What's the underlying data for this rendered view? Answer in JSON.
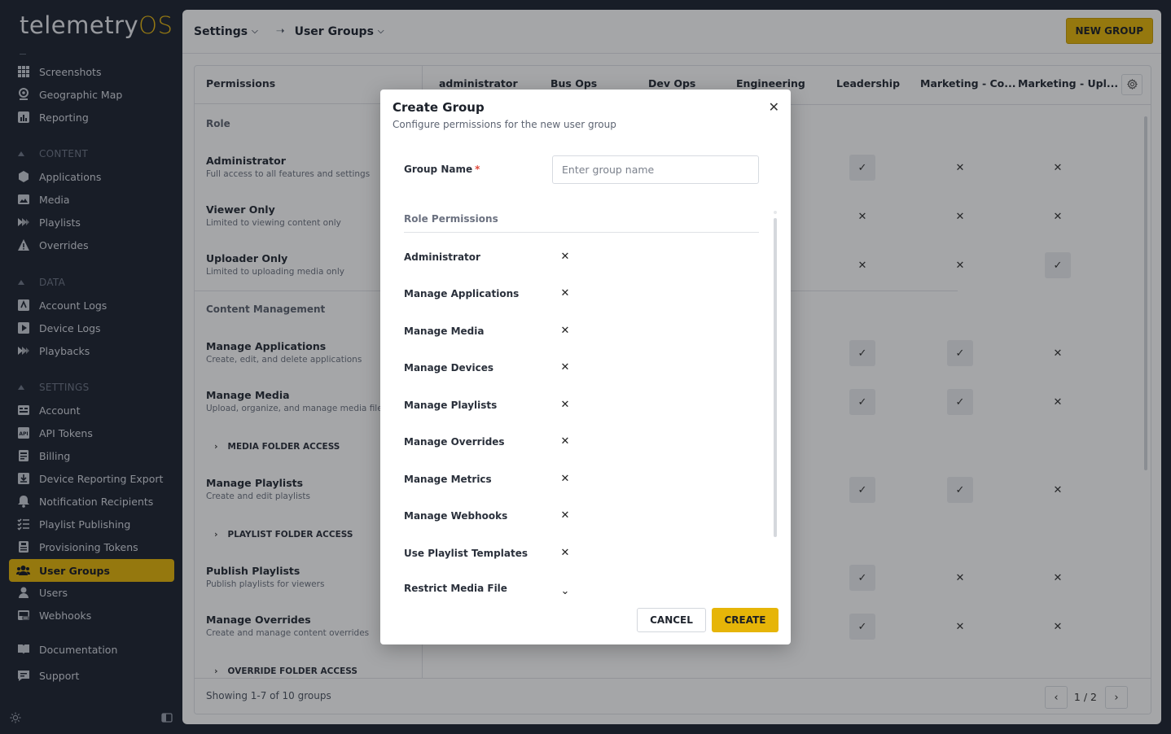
{
  "app": {
    "logo_main": "telemetry",
    "logo_accent": "OS"
  },
  "sidebar": {
    "items_top": [
      {
        "label": "Screenshots",
        "icon": "grid-icon"
      },
      {
        "label": "Geographic Map",
        "icon": "map-pin-icon"
      },
      {
        "label": "Reporting",
        "icon": "chart-icon"
      }
    ],
    "content_section": "CONTENT",
    "content_items": [
      {
        "label": "Applications",
        "icon": "cube-icon"
      },
      {
        "label": "Media",
        "icon": "image-icon"
      },
      {
        "label": "Playlists",
        "icon": "playlist-icon"
      },
      {
        "label": "Overrides",
        "icon": "warning-icon"
      }
    ],
    "data_section": "DATA",
    "data_items": [
      {
        "label": "Account Logs",
        "icon": "log-icon"
      },
      {
        "label": "Device Logs",
        "icon": "play-icon"
      },
      {
        "label": "Playbacks",
        "icon": "playback-icon"
      }
    ],
    "settings_section": "SETTINGS",
    "settings_items": [
      {
        "label": "Account",
        "icon": "id-card-icon"
      },
      {
        "label": "API Tokens",
        "icon": "api-icon"
      },
      {
        "label": "Billing",
        "icon": "billing-icon"
      },
      {
        "label": "Device Reporting Export",
        "icon": "download-icon"
      },
      {
        "label": "Notification Recipients",
        "icon": "bell-icon"
      },
      {
        "label": "Playlist Publishing",
        "icon": "checklist-icon"
      },
      {
        "label": "Provisioning Tokens",
        "icon": "token-icon"
      },
      {
        "label": "User Groups",
        "icon": "users-icon",
        "active": true
      },
      {
        "label": "Users",
        "icon": "user-icon"
      },
      {
        "label": "Webhooks",
        "icon": "webhook-icon"
      }
    ],
    "footer_items": [
      {
        "label": "Documentation",
        "icon": "book-icon"
      },
      {
        "label": "Support",
        "icon": "chat-icon"
      }
    ]
  },
  "header": {
    "crumb1": "Settings",
    "crumb2": "User Groups",
    "new_group": "NEW GROUP"
  },
  "table": {
    "permissions_header": "Permissions",
    "columns": [
      "administrator",
      "Bus Ops",
      "Dev Ops",
      "Engineering",
      "Leadership",
      "Marketing - Co...",
      "Marketing - Upl..."
    ],
    "role_section": "Role",
    "content_section": "Content Management",
    "rows": [
      {
        "title": "Administrator",
        "desc": "Full access to all features and settings"
      },
      {
        "title": "Viewer Only",
        "desc": "Limited to viewing content only"
      },
      {
        "title": "Uploader Only",
        "desc": "Limited to uploading media only"
      },
      {
        "title": "Manage Applications",
        "desc": "Create, edit, and delete applications"
      },
      {
        "title": "Manage Media",
        "desc": "Upload, organize, and manage media files"
      },
      {
        "title": "Manage Playlists",
        "desc": "Create and edit playlists"
      },
      {
        "title": "Publish Playlists",
        "desc": "Publish playlists for viewers"
      },
      {
        "title": "Manage Overrides",
        "desc": "Create and manage content overrides"
      }
    ],
    "folder_media": "MEDIA FOLDER ACCESS",
    "folder_playlist": "PLAYLIST FOLDER ACCESS",
    "folder_override": "OVERRIDE FOLDER ACCESS",
    "footer_count": "Showing 1-7 of 10 groups",
    "page": "1 / 2"
  },
  "modal": {
    "title": "Create Group",
    "subtitle": "Configure permissions for the new user group",
    "group_name_label": "Group Name",
    "required_mark": "*",
    "group_name_placeholder": "Enter group name",
    "group_name_value": "",
    "role_permissions_title": "Role Permissions",
    "permissions": [
      "Administrator",
      "Manage Applications",
      "Manage Media",
      "Manage Devices",
      "Manage Playlists",
      "Manage Overrides",
      "Manage Metrics",
      "Manage Webhooks",
      "Use Playlist Templates",
      "Restrict Media File"
    ],
    "cancel": "CANCEL",
    "create": "CREATE"
  },
  "colors": {
    "accent": "#e6b508",
    "sidebar_bg": "#1c2230"
  }
}
